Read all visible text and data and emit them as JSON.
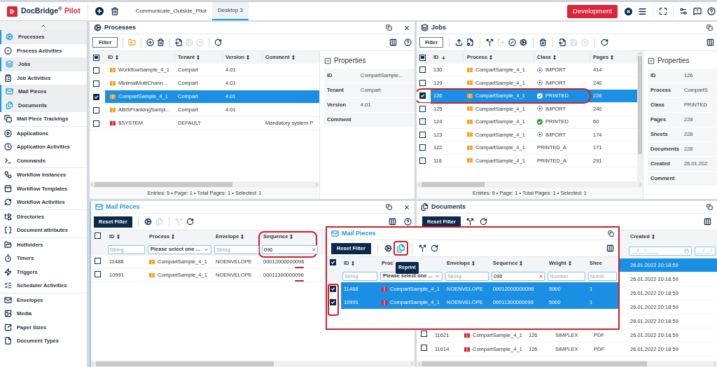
{
  "header": {
    "brand": "DocBridge$^{®}$",
    "product": "Pilot",
    "tabs": [
      {
        "label": "Communicate_Outside_Pilot",
        "selected": false
      },
      {
        "label": "Desktop 3",
        "selected": true
      }
    ],
    "environment": "Development"
  },
  "sidebar": {
    "groups": [
      [
        {
          "label": "Processes",
          "selected": true
        },
        {
          "label": "Process Activities",
          "selected": false
        },
        {
          "label": "Jobs",
          "selected": true
        },
        {
          "label": "Job Activities",
          "selected": false
        },
        {
          "label": "Mail Pieces",
          "selected": true
        },
        {
          "label": "Documents",
          "selected": true
        },
        {
          "label": "Mail Piece Trackings",
          "selected": false
        }
      ],
      [
        {
          "label": "Applications",
          "selected": false
        },
        {
          "label": "Application Activities",
          "selected": false
        },
        {
          "label": "Commands",
          "selected": false
        }
      ],
      [
        {
          "label": "Workflow Instances",
          "selected": false
        },
        {
          "label": "Workflow Templates",
          "selected": false
        },
        {
          "label": "Workflow Activities",
          "selected": false
        }
      ],
      [
        {
          "label": "Directories",
          "selected": false
        },
        {
          "label": "Document attributes",
          "selected": false
        }
      ],
      [
        {
          "label": "Hotfolders",
          "selected": false
        },
        {
          "label": "Timers",
          "selected": false
        },
        {
          "label": "Triggers",
          "selected": false
        },
        {
          "label": "Scheduler Activities",
          "selected": false
        }
      ],
      [
        {
          "label": "Envelopes",
          "selected": false
        },
        {
          "label": "Media",
          "selected": false
        },
        {
          "label": "Paper Sizes",
          "selected": false
        },
        {
          "label": "Document Types",
          "selected": false
        }
      ]
    ]
  },
  "processes": {
    "title": "Processes",
    "filter": "Filter",
    "indeterminate": true,
    "columns": [
      "ID",
      "Tenant",
      "Version",
      "Comment"
    ],
    "rows": [
      {
        "checked": false,
        "selected": false,
        "color": "#f0a020",
        "id": "WorkflowSample_4_1",
        "tenant": "Compart",
        "version": "4.01"
      },
      {
        "checked": false,
        "selected": false,
        "color": "#f0a020",
        "id": "MinimalMultiChann...",
        "tenant": "Compart",
        "version": "4.01"
      },
      {
        "checked": true,
        "selected": true,
        "color": "#f0a020",
        "id": "CompartSample_4_1",
        "tenant": "Compart",
        "version": "4.01"
      },
      {
        "checked": false,
        "selected": false,
        "color": "#f0a020",
        "id": "ABISFrankingSampl...",
        "tenant": "Compart",
        "version": "4.01"
      },
      {
        "checked": false,
        "selected": false,
        "color": "#d9263b",
        "id": "$SYSTEM",
        "tenant": "DEFAULT",
        "comment": "Mandatory system P"
      }
    ],
    "status": "Entries: 5 • Page: 1 • Total Pages: 1 • Selected: 1",
    "properties": {
      "title": "Properties",
      "fields": [
        {
          "label": "ID",
          "value": "CompartSample..."
        },
        {
          "label": "Tenant",
          "value": "Compart"
        },
        {
          "label": "Version",
          "value": "4.01"
        },
        {
          "label": "Comment"
        }
      ]
    }
  },
  "jobs": {
    "title": "Jobs",
    "filter": "Filter",
    "indeterminate": true,
    "columns": [
      {
        "label": "ID",
        "sorted": true
      },
      {
        "label": "Process",
        "sorted": false
      },
      {
        "label": "Class",
        "sorted": false
      },
      {
        "label": "Pages",
        "sorted": false
      }
    ],
    "rows": [
      {
        "checked": false,
        "selected": false,
        "outlined": false,
        "id": "130",
        "process": "CompartSample_4_1",
        "class": "IMPORT",
        "kind": "import",
        "pages": "414"
      },
      {
        "checked": false,
        "selected": false,
        "outlined": false,
        "id": "129",
        "process": "CompartSample_4_1",
        "class": "IMPORT",
        "kind": "import",
        "pages": "240"
      },
      {
        "checked": true,
        "selected": true,
        "outlined": true,
        "id": "126",
        "process": "CompartSample_4_1",
        "class": "PRINTED",
        "kind": "printed",
        "pages": "228"
      },
      {
        "checked": false,
        "selected": false,
        "outlined": false,
        "id": "125",
        "process": "CompartSample_4_1",
        "class": "IMPORT",
        "kind": "import",
        "pages": "240"
      },
      {
        "checked": false,
        "selected": false,
        "outlined": false,
        "id": "124",
        "process": "CompartSample_4_1",
        "class": "PRINTED",
        "kind": "printed",
        "pages": "60"
      },
      {
        "checked": false,
        "selected": false,
        "outlined": false,
        "id": "123",
        "process": "CompartSample_4_1",
        "class": "IMPORT",
        "kind": "import",
        "pages": "174"
      },
      {
        "checked": false,
        "selected": false,
        "outlined": false,
        "id": "122",
        "process": "CompartSample_4_1",
        "class": "PRINTED_A",
        "kind": "plain",
        "pages": "171"
      },
      {
        "checked": false,
        "selected": false,
        "outlined": false,
        "id": "118",
        "process": "CompartSample_4_1",
        "class": "PRINTED_A",
        "kind": "plain",
        "pages": "291"
      }
    ],
    "status": "Entries: 9 • Page: 1 • Total Pages: 1 • Selected: 1",
    "properties": {
      "title": "Properties",
      "fields": [
        {
          "label": "ID",
          "value": "126"
        },
        {
          "label": "Process",
          "value": "CompartS"
        },
        {
          "label": "Class",
          "value": "PRINTED"
        },
        {
          "label": "Pages",
          "value": "228"
        },
        {
          "label": "Sheets",
          "value": "228"
        },
        {
          "label": "Documents",
          "value": "228"
        },
        {
          "label": "Created",
          "value": "26.01.202"
        },
        {
          "label": "Comment"
        }
      ]
    }
  },
  "mail_pieces": {
    "title": "Mail Pieces",
    "reset": "Reset Filter",
    "all_checked": false,
    "columns": [
      {
        "label": "ID",
        "outlined": false
      },
      {
        "label": "Process",
        "outlined": false
      },
      {
        "label": "Envelope",
        "outlined": false
      },
      {
        "label": "Sequence",
        "outlined": true
      }
    ],
    "filters": [
      {
        "kind": "text",
        "placeholder": "String"
      },
      {
        "kind": "select",
        "value": "Please select one ..."
      },
      {
        "kind": "text",
        "placeholder": "String"
      },
      {
        "kind": "text",
        "value": "096",
        "clearable": true
      }
    ],
    "rows": [
      {
        "checked": false,
        "underlined": true,
        "id": "11488",
        "process": "CompartSample_4_1",
        "envelope": "NOENVELOPE",
        "sequence": "00012000000096"
      },
      {
        "checked": false,
        "underlined": true,
        "id": "10991",
        "process": "CompartSample_4_1",
        "envelope": "NOENVELOPE",
        "sequence": "00011300000096"
      }
    ]
  },
  "documents": {
    "title": "Documents",
    "reset": "Reset Filter",
    "columns": [
      "Created"
    ],
    "date_filters": [
      "__/__/____",
      "__/__/"
    ],
    "rows": [
      {
        "selected": true,
        "created": "26.01.2022 20:18:59"
      },
      {
        "selected": false,
        "created": "26.01.2022 20:18:59"
      },
      {
        "selected": false,
        "created": "26.01.2022 20:18:59"
      },
      {
        "selected": false,
        "created": "26.01.2022 20:18:59"
      },
      {
        "selected": false,
        "created": "26.01.2022 20:18:59"
      },
      {
        "selected": false,
        "checked": false,
        "id": "11621",
        "process": "CompartSample_4_1",
        "job": "126",
        "mode": "SIMPLEX",
        "type": "PDF",
        "created": "26.01.2022 20:18:59"
      },
      {
        "selected": false,
        "checked": false,
        "id": "11614",
        "process": "CompartSample_4_1",
        "job": "126",
        "mode": "SIMPLEX",
        "type": "PDF",
        "created": "26.01.2022 20:18:59"
      }
    ]
  },
  "callout": {
    "title": "Mail Pieces",
    "reset": "Reset Filter",
    "tooltip": "Reprint",
    "reprint_outlined": true,
    "checkbox_outlined": true,
    "all_checked": true,
    "columns": [
      "ID",
      "Proc",
      "Envelope",
      "Sequence",
      "Weight",
      "Shee"
    ],
    "filters": [
      {
        "kind": "text",
        "placeholder": "String"
      },
      {
        "kind": "select",
        "value": "Please select one ..."
      },
      {
        "kind": "text",
        "placeholder": "String"
      },
      {
        "kind": "text",
        "value": "096",
        "clearable": true
      },
      {
        "kind": "text",
        "placeholder": "Number"
      },
      {
        "kind": "text",
        "placeholder": "Numb"
      }
    ],
    "rows": [
      {
        "checked": true,
        "selected": true,
        "id": "11488",
        "process": "CompartSample_4_1",
        "envelope": "NOENVELOPE",
        "sequence": "00012000000096",
        "weight": "5000",
        "sheets": "1"
      },
      {
        "checked": true,
        "selected": true,
        "id": "10991",
        "process": "CompartSample_4_1",
        "envelope": "NOENVELOPE",
        "sequence": "00011300000096",
        "weight": "5000",
        "sheets": "1"
      }
    ]
  }
}
